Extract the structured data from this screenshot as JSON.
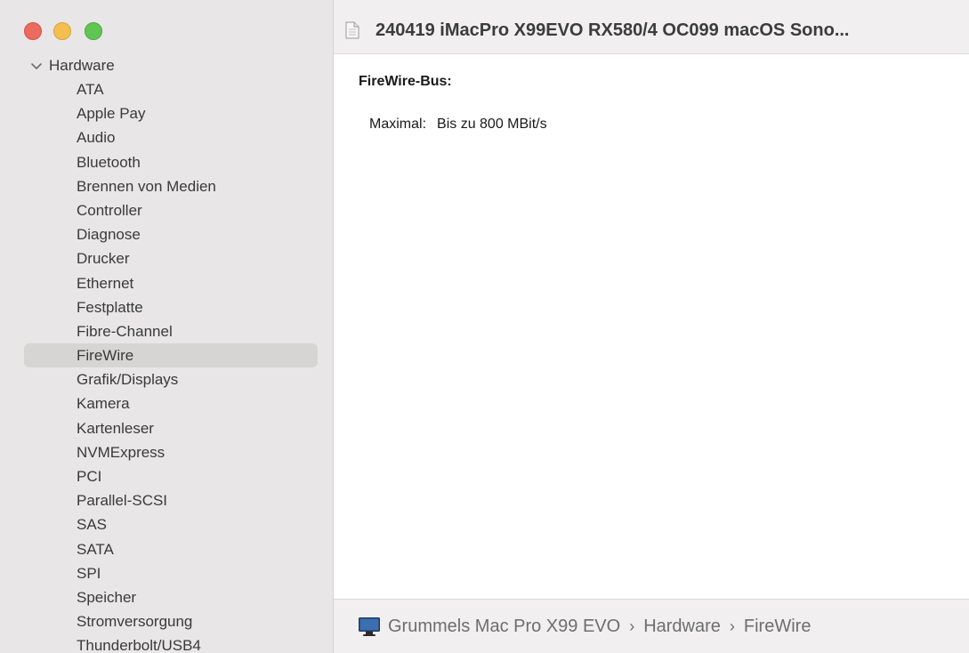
{
  "window": {
    "title": "240419 iMacPro X99EVO RX580/4 OC099 macOS Sono..."
  },
  "sidebar": {
    "section_label": "Hardware",
    "items": [
      {
        "label": "ATA"
      },
      {
        "label": "Apple Pay"
      },
      {
        "label": "Audio"
      },
      {
        "label": "Bluetooth"
      },
      {
        "label": "Brennen von Medien"
      },
      {
        "label": "Controller"
      },
      {
        "label": "Diagnose"
      },
      {
        "label": "Drucker"
      },
      {
        "label": "Ethernet"
      },
      {
        "label": "Festplatte"
      },
      {
        "label": "Fibre-Channel"
      },
      {
        "label": "FireWire",
        "selected": true
      },
      {
        "label": "Grafik/Displays"
      },
      {
        "label": "Kamera"
      },
      {
        "label": "Kartenleser"
      },
      {
        "label": "NVMExpress"
      },
      {
        "label": "PCI"
      },
      {
        "label": "Parallel-SCSI"
      },
      {
        "label": "SAS"
      },
      {
        "label": "SATA"
      },
      {
        "label": "SPI"
      },
      {
        "label": "Speicher"
      },
      {
        "label": "Stromversorgung"
      },
      {
        "label": "Thunderbolt/USB4"
      }
    ]
  },
  "content": {
    "heading": "FireWire-Bus:",
    "properties": [
      {
        "key": "Maximal:",
        "value": "Bis zu 800 MBit/s"
      }
    ]
  },
  "pathbar": {
    "computer": "Grummels Mac Pro X99 EVO",
    "separator": "›",
    "section": "Hardware",
    "item": "FireWire"
  },
  "icons": {
    "document": "document-icon",
    "computer": "computer-icon",
    "disclosure": "chevron-down-icon"
  },
  "colors": {
    "close": "#ed6a5e",
    "minimize": "#f5bf4f",
    "zoom": "#61c554",
    "selection": "#d7d4d4"
  }
}
